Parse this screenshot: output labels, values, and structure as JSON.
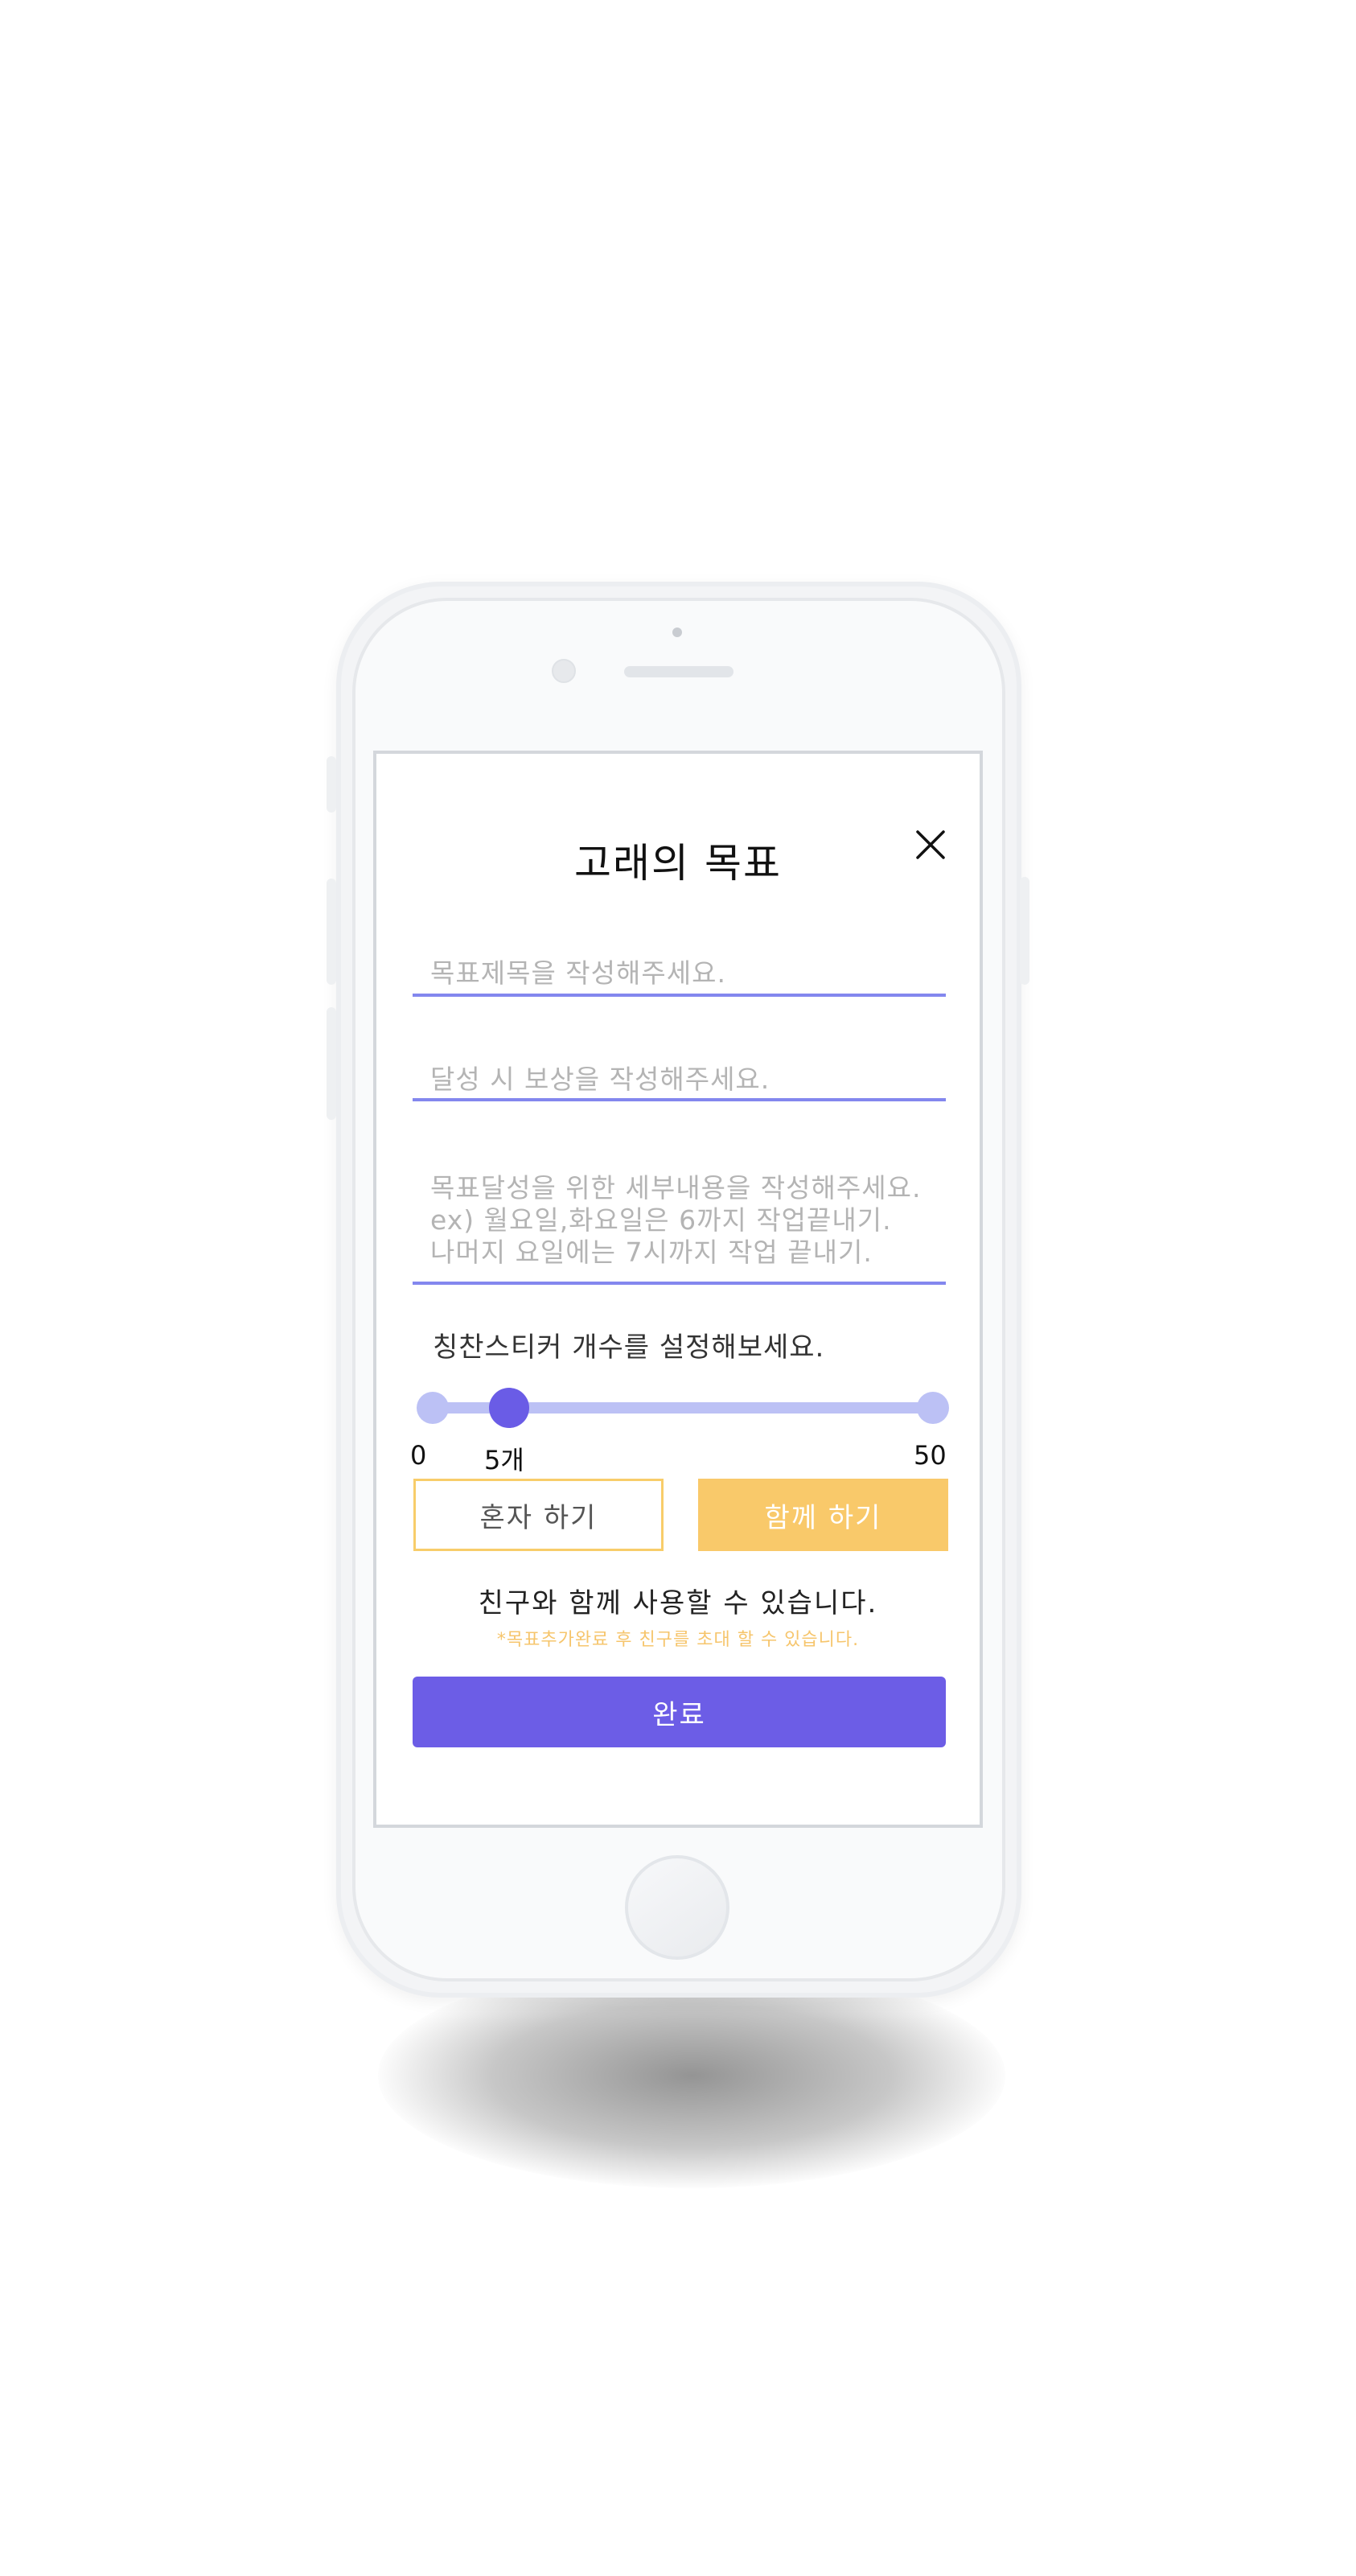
{
  "header": {
    "title": "고래의 목표"
  },
  "form": {
    "goal_title_placeholder": "목표제목을 작성해주세요.",
    "reward_placeholder": "달성 시 보상을 작성해주세요.",
    "detail_placeholder_lines": [
      "목표달성을 위한 세부내용을 작성해주세요.",
      "ex) 월요일,화요일은 6까지 작업끝내기.",
      "나머지 요일에는 7시까지 작업 끝내기."
    ]
  },
  "sticker": {
    "label": "칭찬스티커 개수를 설정해보세요.",
    "min_label": "0",
    "max_label": "50",
    "value_label": "5개",
    "value": 5,
    "min": 0,
    "max": 50
  },
  "mode": {
    "solo_label": "혼자 하기",
    "together_label": "함께 하기",
    "selected": "together"
  },
  "friend": {
    "message": "친구와 함께 사용할 수 있습니다.",
    "note": "*목표추가완료 후 친구를 초대 할 수 있습니다."
  },
  "actions": {
    "done_label": "완료"
  },
  "colors": {
    "accent_purple": "#6c5de6",
    "underline_purple": "#8387ee",
    "slider_track": "#bcc1f5",
    "accent_yellow": "#f9c96a",
    "placeholder_gray": "#b4b4b4"
  },
  "icons": {
    "close": "close-icon"
  }
}
